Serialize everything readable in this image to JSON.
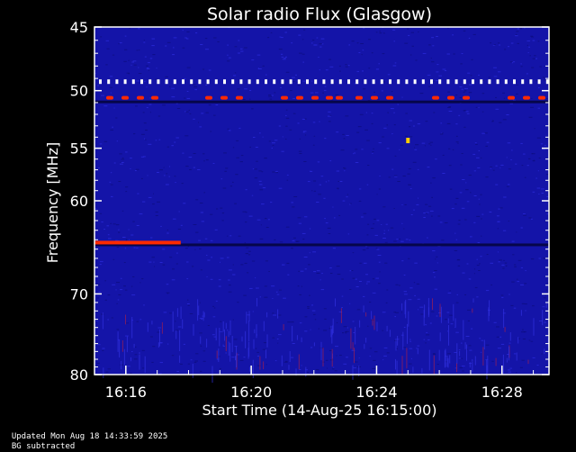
{
  "chart_data": {
    "type": "heatmap",
    "title": "Solar radio Flux (Glasgow)",
    "ylabel": "Frequency [MHz]",
    "xlabel": "Start Time (14-Aug-25 16:15:00)",
    "ylim": [
      45,
      80
    ],
    "y_scale": "log",
    "y_ticks": [
      45,
      50,
      55,
      60,
      70,
      80
    ],
    "x_ticks": [
      "16:16",
      "16:20",
      "16:24",
      "16:28"
    ],
    "x_range": [
      "16:15:00",
      "16:29:30"
    ],
    "colors": {
      "background": "#1414a8",
      "interference": "#ff2a00",
      "marker": "#ffffff",
      "frame": "#ffffff"
    },
    "features": {
      "marker_row_mhz": 49.3,
      "interference_band_mhz": 50.6,
      "strong_band_mhz": 64.3,
      "strong_band_end": "16:17:45",
      "burst_mhz": 54.3,
      "burst_time": "16:25:00"
    }
  },
  "footer": {
    "updated": "Updated Mon Aug 18 14:33:59 2025",
    "note": "BG subtracted"
  }
}
